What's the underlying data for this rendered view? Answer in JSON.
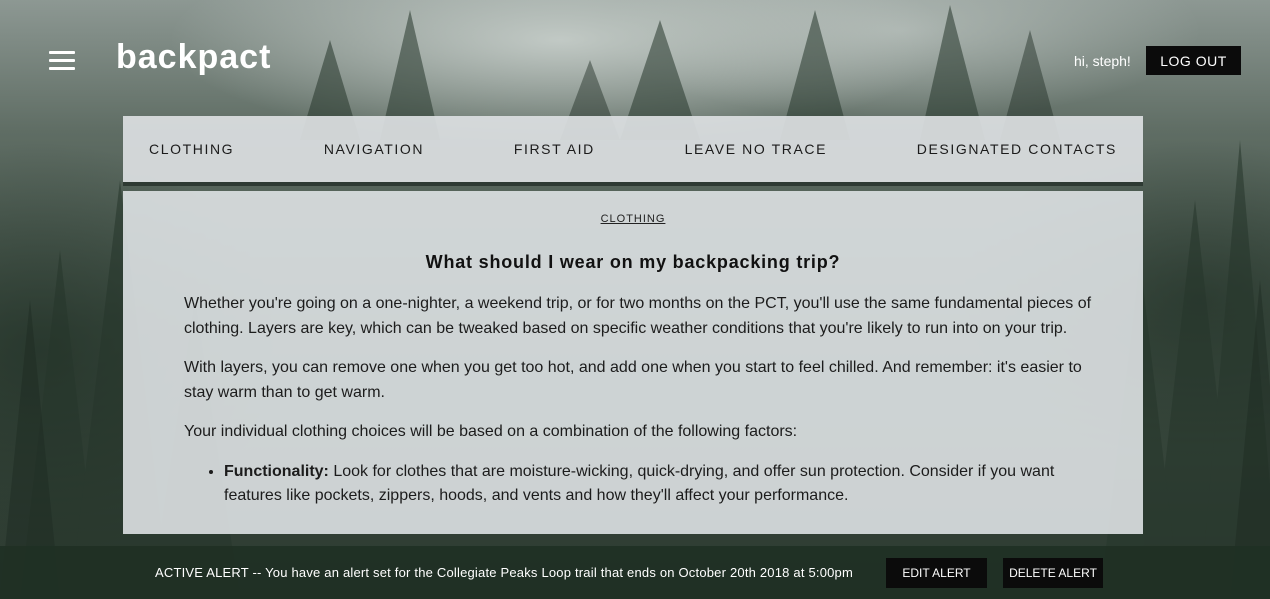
{
  "header": {
    "brand": "backpact",
    "greeting": "hi, steph!",
    "logout_label": "LOG OUT"
  },
  "tabs": [
    {
      "label": "CLOTHING"
    },
    {
      "label": "NAVIGATION"
    },
    {
      "label": "FIRST AID"
    },
    {
      "label": "LEAVE NO TRACE"
    },
    {
      "label": "DESIGNATED CONTACTS"
    }
  ],
  "article": {
    "breadcrumb": "CLOTHING",
    "title": "What should I wear on my backpacking trip?",
    "paragraphs": [
      "Whether you're going on a one-nighter, a weekend trip, or for two months on the PCT, you'll use the same fundamental pieces of clothing. Layers are key, which can be tweaked based on specific weather conditions that you're likely to run into on your trip.",
      "With layers, you can remove one when you get too hot, and add one when you start to feel chilled. And remember: it's easier to stay warm than to get warm.",
      "Your individual clothing choices will be based on a combination of the following factors:"
    ],
    "factors": [
      {
        "term": "Functionality:",
        "text": " Look for clothes that are moisture-wicking, quick-drying, and offer sun protection. Consider if you want features like pockets, zippers, hoods, and vents and how they'll affect your performance."
      }
    ]
  },
  "alert": {
    "text": "ACTIVE ALERT -- You have an alert set for the Collegiate Peaks Loop trail that ends on October 20th 2018 at 5:00pm",
    "edit_label": "EDIT ALERT",
    "delete_label": "DELETE ALERT"
  },
  "icons": {
    "menu": "hamburger-menu-icon"
  }
}
